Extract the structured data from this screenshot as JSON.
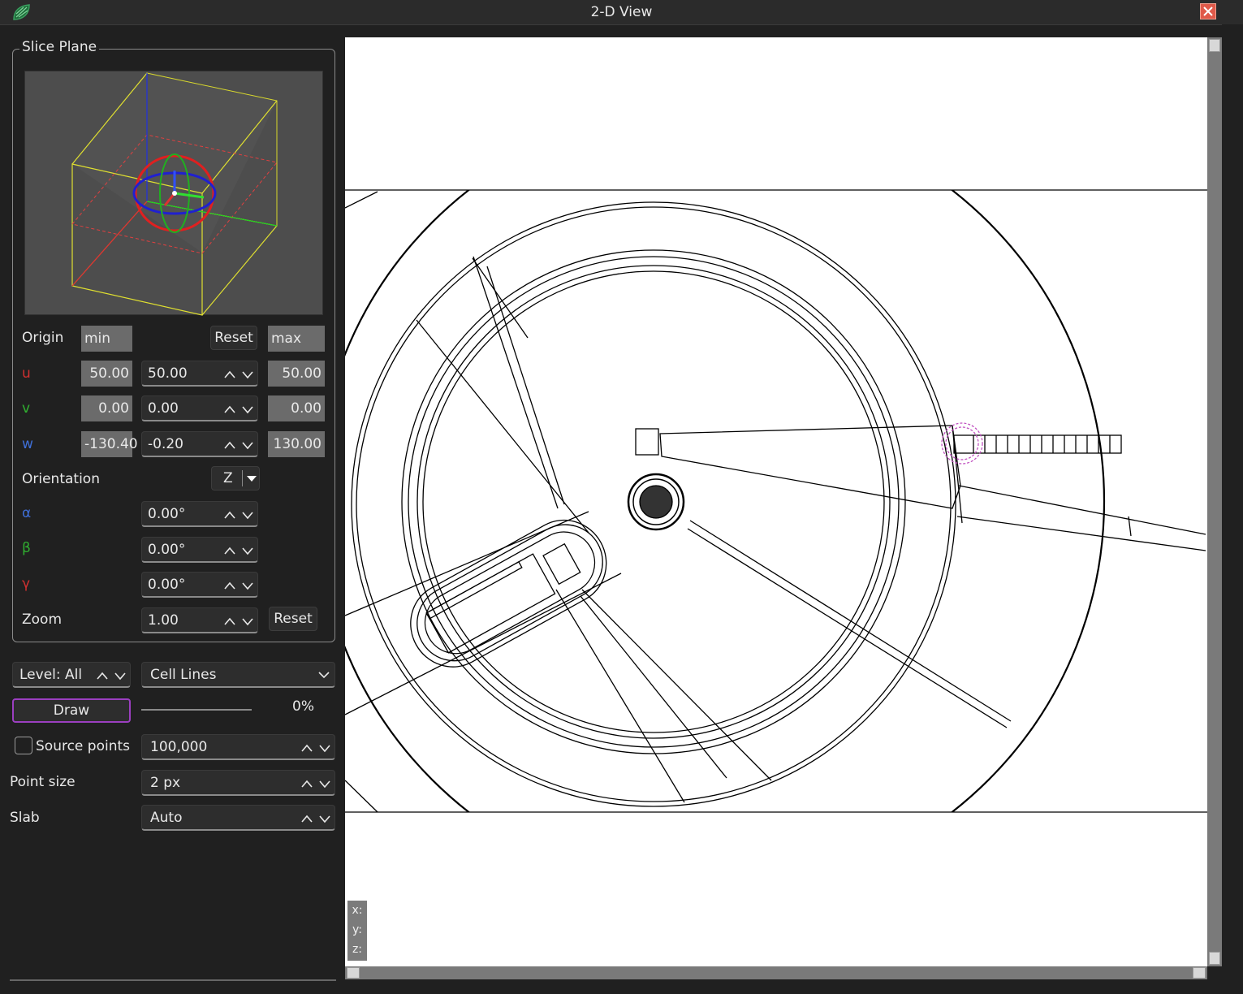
{
  "window": {
    "title": "2-D View"
  },
  "slice_plane": {
    "group_title": "Slice Plane",
    "origin": {
      "label": "Origin",
      "min_header": "min",
      "max_header": "max",
      "reset_label": "Reset"
    },
    "u": {
      "label": "u",
      "min": "50.00",
      "value": "50.00",
      "max": "50.00"
    },
    "v": {
      "label": "v",
      "min": "0.00",
      "value": "0.00",
      "max": "0.00"
    },
    "w": {
      "label": "w",
      "min": "-130.40",
      "value": "-0.20",
      "max": "130.00"
    },
    "orientation": {
      "label": "Orientation",
      "value": "Z"
    },
    "alpha": {
      "label": "α",
      "value": "0.00°"
    },
    "beta": {
      "label": "β",
      "value": "0.00°"
    },
    "gamma": {
      "label": "γ",
      "value": "0.00°"
    },
    "zoom": {
      "label": "Zoom",
      "value": "1.00",
      "reset_label": "Reset"
    }
  },
  "controls": {
    "level": "Level: All",
    "mode": "Cell Lines",
    "draw_label": "Draw",
    "progress_text": "0%",
    "progress": 0,
    "source_points": {
      "label": "Source points",
      "checked": false,
      "value": "100,000"
    },
    "point_size": {
      "label": "Point size",
      "value": "2 px"
    },
    "slab": {
      "label": "Slab",
      "value": "Auto"
    }
  },
  "view": {
    "coords": {
      "x": "x:",
      "y": "y:",
      "z": "z:"
    }
  },
  "colors": {
    "accent": "#9b3fc0",
    "close": "#e05a4a",
    "u_axis": "#d03030",
    "v_axis": "#30b030",
    "w_axis": "#3f6fd8"
  }
}
